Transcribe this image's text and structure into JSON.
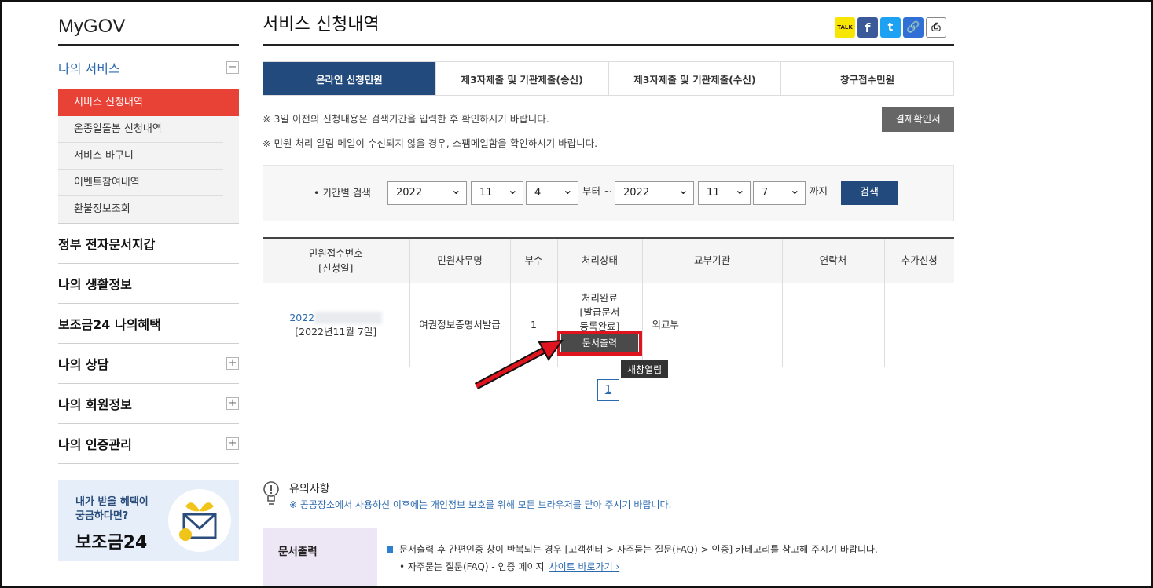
{
  "sidebar": {
    "brand": "MyGOV",
    "my_services": "나의 서비스",
    "toggle_minus": "−",
    "toggle_plus": "+",
    "sub_items": [
      "서비스 신청내역",
      "온종일돌봄 신청내역",
      "서비스 바구니",
      "이벤트참여내역",
      "환불정보조회"
    ],
    "sections": [
      "정부 전자문서지갑",
      "나의 생활정보",
      "보조금24 나의혜택",
      "나의 상담",
      "나의 회원정보",
      "나의 인증관리"
    ],
    "banner_line1": "내가 받을 혜택이",
    "banner_line2": "궁금하다면?",
    "banner_big": "보조금24"
  },
  "main": {
    "title": "서비스 신청내역",
    "share": {
      "kakao": "TALK",
      "facebook": "f",
      "twitter": "t",
      "link": "🔗",
      "print": "⎙"
    },
    "tabs": [
      "온라인 신청민원",
      "제3자제출 및 기관제출(송신)",
      "제3자제출 및 기관제출(수신)",
      "창구접수민원"
    ],
    "notice1": "※ 3일 이전의 신청내용은 검색기간을 입력한 후 확인하시기 바랍니다.",
    "notice2": "※ 민원 처리 알림 메일이 수신되지 않을 경우, 스팸메일함을 확인하시기 바랍니다.",
    "receipt_button": "결제확인서",
    "search": {
      "label": "• 기간별 검색",
      "from_year": "2022",
      "from_month": "11",
      "from_day": "4",
      "from_text": "부터 ~",
      "to_year": "2022",
      "to_month": "11",
      "to_day": "7",
      "to_text": "까지",
      "button": "검색"
    },
    "table": {
      "headers": [
        "민원접수번호",
        "[신청일]",
        "민원사무명",
        "부수",
        "처리상태",
        "교부기관",
        "연락처",
        "추가신청"
      ],
      "row": {
        "number_prefix": "2022",
        "date": "[2022년11월 7일]",
        "name": "여권정보증명서발급",
        "count": "1",
        "status1": "처리완료",
        "status2": "[발급문서",
        "status3": "등록완료]",
        "print_button": "문서출력",
        "agency": "외교부"
      }
    },
    "tooltip": "새창열림",
    "page": "1",
    "caution_title": "유의사항",
    "caution_text": "※ 공공장소에서 사용하신 이후에는 개인정보 보호를 위해 모든 브라우저를 닫아 주시기 바랍니다.",
    "info_label": "문서출력",
    "info_line1": "문서출력 후 간편인증 창이 반복되는 경우 [고객센터 > 자주묻는 질문(FAQ) > 인증] 카테고리를 참고해 주시기 바랍니다.",
    "info_line2": "• 자주묻는 질문(FAQ) - 인증 페이지",
    "info_link": "사이트 바로가기 ›"
  }
}
